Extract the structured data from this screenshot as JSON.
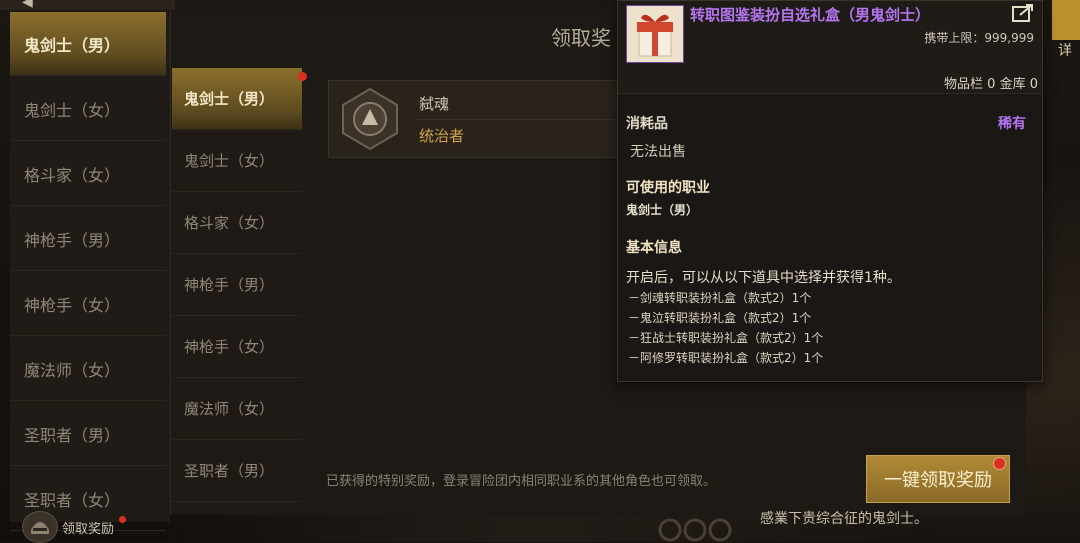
{
  "sidebar": {
    "items": [
      {
        "label": "鬼剑士（男）",
        "active": true
      },
      {
        "label": "鬼剑士（女）"
      },
      {
        "label": "格斗家（女）"
      },
      {
        "label": "神枪手（男）"
      },
      {
        "label": "神枪手（女）"
      },
      {
        "label": "魔法师（女）"
      },
      {
        "label": "圣职者（男）"
      },
      {
        "label": "圣职者（女）"
      }
    ],
    "claim_label": "领取奖励",
    "claim_icon": "helmet-icon"
  },
  "panel": {
    "title": "领取奖",
    "inner_list": [
      {
        "label": "鬼剑士（男）",
        "active": true
      },
      {
        "label": "鬼剑士（女）"
      },
      {
        "label": "格斗家（女）"
      },
      {
        "label": "神枪手（男）"
      },
      {
        "label": "神枪手（女）"
      },
      {
        "label": "魔法师（女）"
      },
      {
        "label": "圣职者（男）"
      }
    ],
    "reward": {
      "name": "弑魂",
      "title": "统治者",
      "icon": "emblem-icon"
    },
    "footnote": "已获得的特别奖励，登录冒险团内相同职业系的其他角色也可领取。",
    "claim_all_label": "一键领取奖励",
    "bottom_text": "感業下贵综合征的鬼剑士。",
    "right_edge_label": "详"
  },
  "tooltip": {
    "name": "转职图鉴装扮自选礼盒（男鬼剑士）",
    "carry_limit": "携带上限：999,999",
    "storage": "物品栏 0 金库 0",
    "category": "消耗品",
    "rarity": "稀有",
    "sell": "无法出售",
    "job_header": "可使用的职业",
    "job": "鬼剑士（男）",
    "info_header": "基本信息",
    "desc": "开启后，可以从以下道具中选择并获得1种。",
    "options": [
      "－剑魂转职装扮礼盒（款式2）1个",
      "－鬼泣转职装扮礼盒（款式2）1个",
      "－狂战士转职装扮礼盒（款式2）1个",
      "－阿修罗转职装扮礼盒（款式2）1个"
    ],
    "colors": {
      "rare": "#b575f0",
      "accent": "#d2a44a"
    }
  }
}
